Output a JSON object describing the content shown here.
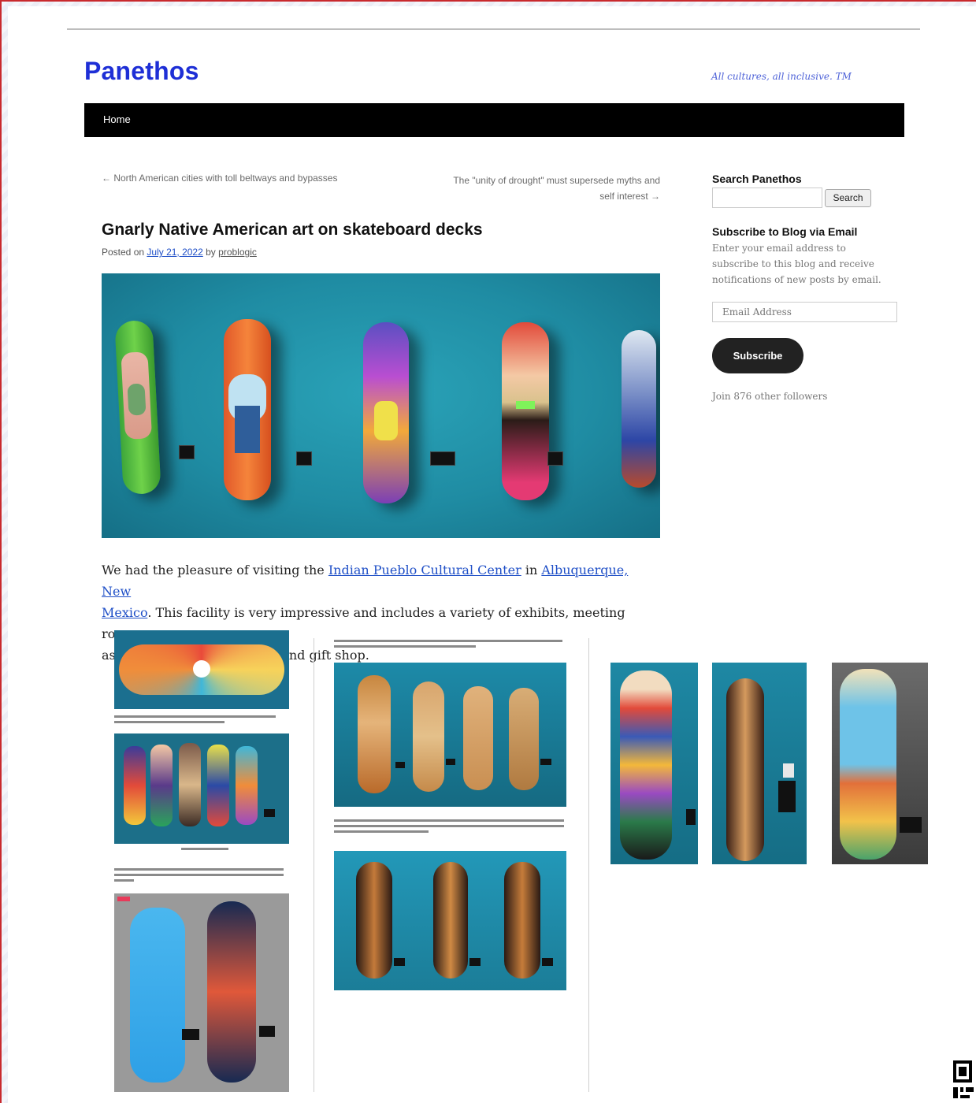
{
  "site": {
    "title": "Panethos",
    "tagline": "All cultures, all inclusive. TM"
  },
  "nav": {
    "home_label": "Home"
  },
  "post_nav": {
    "prev": "← North American cities with toll beltways and bypasses",
    "next_line1": "The \"unity of drought\" must supersede myths and",
    "next_line2": "self interest →"
  },
  "post": {
    "title": "Gnarly Native American art on skateboard decks",
    "posted_on": "Posted on",
    "date": "July 21, 2022",
    "by": "by",
    "author": "problogic",
    "body": {
      "t1": "We had the pleasure of visiting the ",
      "link1": "Indian Pueblo Cultural Center",
      "t2": " in ",
      "link2a": "Albuquerque, New",
      "link2b": "Mexico",
      "t3": ". This facility is very impressive and includes a variety of exhibits, meeting rooms,",
      "t4": "as well as a nice restaurant and gift shop."
    }
  },
  "sidebar": {
    "search_title": "Search Panethos",
    "search_button": "Search",
    "search_value": "",
    "subscribe_title": "Subscribe to Blog via Email",
    "subscribe_desc": "Enter your email address to subscribe to this blog and receive notifications of new posts by email.",
    "email_placeholder": "Email Address",
    "subscribe_button": "Subscribe",
    "followers": "Join 876 other followers"
  },
  "colors": {
    "brand_blue": "#1e2fd6",
    "link_blue": "#1f4fc7",
    "nav_black": "#000000",
    "wall_teal": "#1f8ca3"
  }
}
